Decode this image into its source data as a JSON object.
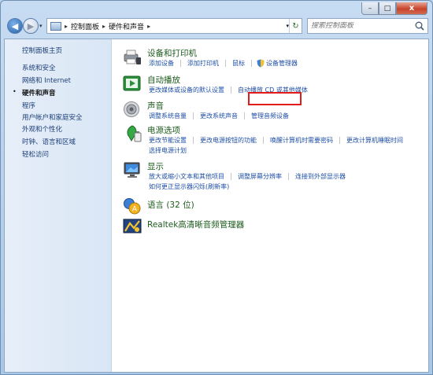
{
  "window": {
    "caption": {
      "minimize": "–",
      "maximize": "□",
      "close": "x"
    }
  },
  "nav": {
    "back": "◀",
    "forward": "▶",
    "dropdown": "▾",
    "breadcrumb": [
      "控制面板",
      "硬件和声音"
    ],
    "sep": "▸",
    "refresh": "↻",
    "search_placeholder": "搜索控制面板"
  },
  "left_pane": {
    "items": [
      {
        "label": "控制面板主页",
        "current": false
      },
      {
        "label": "系统和安全",
        "current": false
      },
      {
        "label": "网络和 Internet",
        "current": false
      },
      {
        "label": "硬件和声音",
        "current": true
      },
      {
        "label": "程序",
        "current": false
      },
      {
        "label": "用户帐户和家庭安全",
        "current": false
      },
      {
        "label": "外观和个性化",
        "current": false
      },
      {
        "label": "时钟、语言和区域",
        "current": false
      },
      {
        "label": "轻松访问",
        "current": false
      }
    ],
    "bullet": "•"
  },
  "sections": [
    {
      "title": "设备和打印机",
      "icon": "printer-icon",
      "links": [
        [
          "添加设备",
          "添加打印机",
          "鼠标",
          "设备管理器"
        ]
      ]
    },
    {
      "title": "自动播放",
      "icon": "autoplay-icon",
      "links": [
        [
          "更改媒体或设备的默认设置",
          "自动播放 CD 或其他媒体"
        ]
      ]
    },
    {
      "title": "声音",
      "icon": "speaker-icon",
      "links": [
        [
          "调整系统音量",
          "更改系统声音",
          "管理音频设备"
        ]
      ]
    },
    {
      "title": "电源选项",
      "icon": "power-icon",
      "links": [
        [
          "更改节能设置",
          "更改电源按钮的功能",
          "唤醒计算机时需要密码",
          "更改计算机睡眠时间"
        ],
        [
          "选择电源计划"
        ]
      ]
    },
    {
      "title": "显示",
      "icon": "display-icon",
      "links": [
        [
          "放大或缩小文本和其他项目",
          "调整屏幕分辨率",
          "连接到外部显示器"
        ],
        [
          "如何更正显示器闪烁(刷新率)"
        ]
      ]
    },
    {
      "title": "语言 (32 位)",
      "icon": "language-icon",
      "links": []
    },
    {
      "title": "Realtek高清晰音频管理器",
      "icon": "realtek-icon",
      "links": []
    }
  ],
  "colors": {
    "link": "#1f4fa5",
    "section_title": "#1e5b1e",
    "highlight": "#e31b1b"
  }
}
